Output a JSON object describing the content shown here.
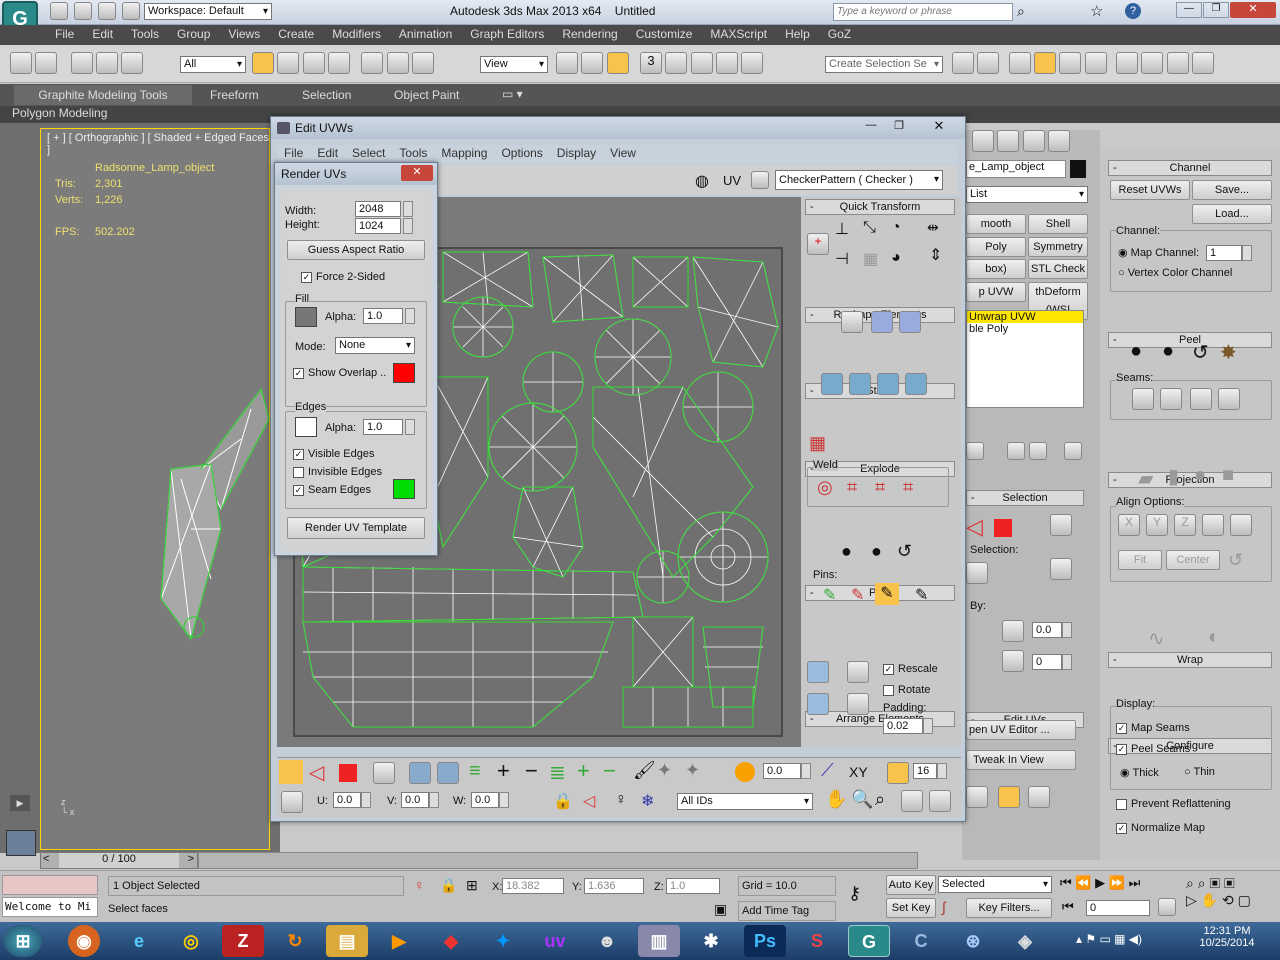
{
  "app": {
    "title": "Autodesk 3ds Max 2013 x64",
    "doc": "Untitled",
    "workspace": "Workspace: Default",
    "search_placeholder": "Type a keyword or phrase",
    "logo": "G"
  },
  "menu": [
    "File",
    "Edit",
    "Tools",
    "Group",
    "Views",
    "Create",
    "Modifiers",
    "Animation",
    "Graph Editors",
    "Rendering",
    "Customize",
    "MAXScript",
    "Help",
    "GoZ"
  ],
  "toolbar": {
    "filter": "All",
    "view": "View",
    "selection_set": "Create Selection Se",
    "snap_value": "3"
  },
  "ribbon": {
    "tabs": [
      "Graphite Modeling Tools",
      "Freeform",
      "Selection",
      "Object Paint"
    ],
    "sub": "Polygon Modeling"
  },
  "viewport": {
    "label": "[ + ] [ Orthographic ] [ Shaded + Edged Faces ]",
    "object": "Radsonne_Lamp_object",
    "tris_label": "Tris:",
    "tris": "2,301",
    "verts_label": "Verts:",
    "verts": "1,226",
    "fps_label": "FPS:",
    "fps": "502.202",
    "timeline": "0 / 100"
  },
  "edit_uvws": {
    "title": "Edit UVWs",
    "menu": [
      "File",
      "Edit",
      "Select",
      "Tools",
      "Mapping",
      "Options",
      "Display",
      "View"
    ],
    "uv_label": "UV",
    "checker": "CheckerPattern  ( Checker )",
    "quick_transform": "Quick Transform",
    "reshape": "Reshape Elements",
    "stitch": "Stitch",
    "explode": "Explode",
    "weld": "Weld",
    "peel": "Peel",
    "pins": "Pins:",
    "arrange": "Arrange Elements",
    "rescale": "Rescale",
    "rotate": "Rotate",
    "padding_label": "Padding:",
    "padding": "0.02",
    "bottom": {
      "spin1": "0.0",
      "xy": "XY",
      "zoom": "16",
      "u_label": "U:",
      "u": "0.0",
      "v_label": "V:",
      "v": "0.0",
      "w_label": "W:",
      "w": "0.0",
      "ids": "All IDs"
    }
  },
  "render_uvs": {
    "title": "Render UVs",
    "width_label": "Width:",
    "width": "2048",
    "height_label": "Height:",
    "height": "1024",
    "guess": "Guess Aspect Ratio",
    "force": "Force 2-Sided",
    "fill": "Fill",
    "alpha_label": "Alpha:",
    "fill_alpha": "1.0",
    "mode_label": "Mode:",
    "mode": "None",
    "show_overlap": "Show Overlap",
    "edges": "Edges",
    "edge_alpha": "1.0",
    "visible_edges": "Visible Edges",
    "invisible_edges": "Invisible Edges",
    "seam_edges": "Seam Edges",
    "render_btn": "Render UV Template",
    "overlap_color": "#ff0000",
    "seam_color": "#00dd00"
  },
  "modify": {
    "object": "e_Lamp_object",
    "list": "List",
    "buttons": [
      [
        "mooth",
        "Shell"
      ],
      [
        "Poly",
        "Symmetry"
      ],
      [
        "box)",
        "STL Check"
      ],
      [
        "p UVW",
        "thDeform (WSI"
      ]
    ],
    "stack": [
      "Unwrap UVW",
      "ble Poly"
    ],
    "selection": "Selection",
    "sel_label": "Selection:",
    "by_label": "By:",
    "by_val1": "0.0",
    "by_val2": "0",
    "edit_uvs": "Edit UVs",
    "open_editor": "pen UV Editor ...",
    "tweak": "Tweak In View"
  },
  "right": {
    "channel": "Channel",
    "reset": "Reset UVWs",
    "save": "Save...",
    "load": "Load...",
    "channel_label": "Channel:",
    "map_channel": "Map Channel:",
    "map_val": "1",
    "vertex_color": "Vertex Color Channel",
    "peel": "Peel",
    "seams": "Seams:",
    "projection": "Projection",
    "align": "Align Options:",
    "fit": "Fit",
    "center": "Center",
    "wrap": "Wrap",
    "configure": "Configure",
    "display": "Display:",
    "map_seams": "Map Seams",
    "peel_seams": "Peel Seams",
    "thick": "Thick",
    "thin": "Thin",
    "prevent": "Prevent Reflattening",
    "normalize": "Normalize Map"
  },
  "status": {
    "selected": "1 Object Selected",
    "prompt": "Select faces",
    "welcome": "Welcome to Mi",
    "x_label": "X:",
    "x": "18.382",
    "y_label": "Y:",
    "y": "1.636",
    "z_label": "Z:",
    "z": "1.0",
    "grid": "Grid = 10.0",
    "add_time_tag": "Add Time Tag",
    "auto_key": "Auto Key",
    "set_key": "Set Key",
    "selected_dd": "Selected",
    "key_filters": "Key Filters...",
    "frame": "0"
  },
  "clock": {
    "time": "12:31 PM",
    "date": "10/25/2014"
  }
}
